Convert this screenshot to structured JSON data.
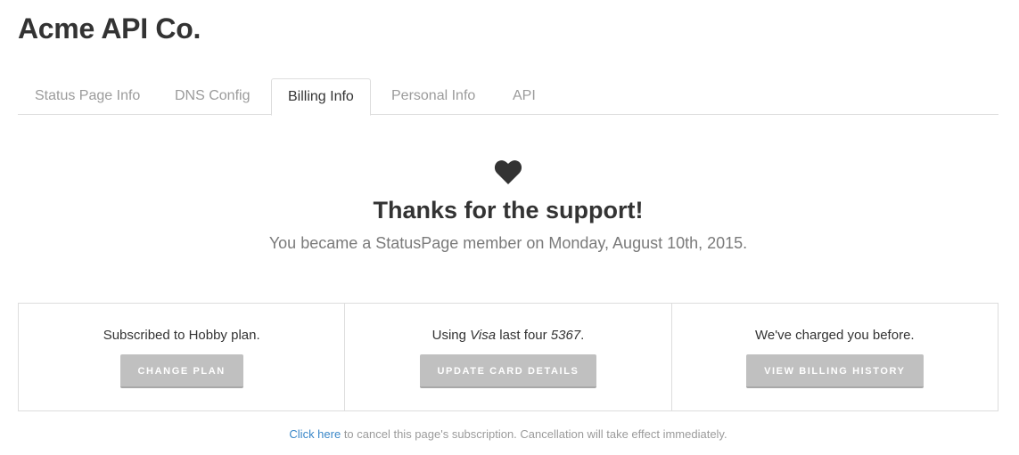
{
  "header": {
    "title": "Acme API Co."
  },
  "tabs": [
    {
      "label": "Status Page Info",
      "active": false
    },
    {
      "label": "DNS Config",
      "active": false
    },
    {
      "label": "Billing Info",
      "active": true
    },
    {
      "label": "Personal Info",
      "active": false
    },
    {
      "label": "API",
      "active": false
    }
  ],
  "hero": {
    "icon": "heart-icon",
    "title": "Thanks for the support!",
    "subtitle": "You became a StatusPage member on Monday, August 10th, 2015."
  },
  "panels": {
    "plan": {
      "text": "Subscribed to Hobby plan.",
      "button_label": "CHANGE PLAN"
    },
    "card": {
      "text_prefix": "Using ",
      "card_brand": "Visa",
      "text_middle": " last four ",
      "last_four": "5367",
      "text_suffix": ".",
      "button_label": "UPDATE CARD DETAILS"
    },
    "history": {
      "text": "We've charged you before.",
      "button_label": "VIEW BILLING HISTORY"
    }
  },
  "footer": {
    "link_text": "Click here",
    "text": " to cancel this page's subscription. Cancellation will take effect immediately."
  },
  "colors": {
    "link": "#3a87c8",
    "button": "#c0c0c0",
    "border": "#dddddd",
    "text_muted": "#9b9b9b"
  }
}
